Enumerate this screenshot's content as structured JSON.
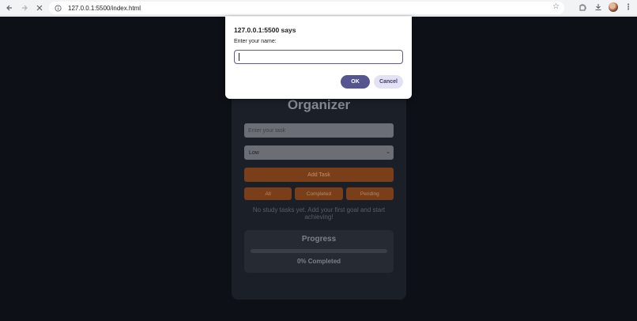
{
  "browser": {
    "url": "127.0.0.1:5500/index.html",
    "icons": [
      "back-arrow-icon",
      "forward-arrow-icon",
      "stop-icon",
      "site-info-icon",
      "bookmark-star-icon",
      "extensions-icon",
      "download-icon",
      "profile-avatar",
      "menu-kebab-icon"
    ]
  },
  "dialog": {
    "title": "127.0.0.1:5500 says",
    "prompt_label": "Enter your name:",
    "input_value": "",
    "ok_label": "OK",
    "cancel_label": "Cancel",
    "accent_color": "#57558f"
  },
  "app": {
    "title": "Organizer",
    "task_placeholder": "Enter your task",
    "priority_selected": "Low",
    "add_button": "Add Task",
    "filters": [
      "All",
      "Completed",
      "Pending"
    ],
    "empty_message": "No study tasks yet. Add your first goal and start achieving!",
    "progress": {
      "title": "Progress",
      "value_percent": 0,
      "label": "0% Completed"
    },
    "accent_color": "#c7641f"
  }
}
